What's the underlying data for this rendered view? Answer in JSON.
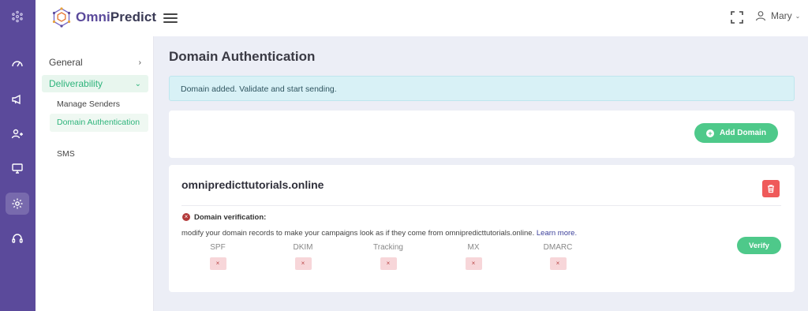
{
  "app": {
    "brand_part1": "Omni",
    "brand_part2": "Predict"
  },
  "rail": {
    "icons": [
      "network-icon",
      "speedometer-icon",
      "megaphone-icon",
      "users-icon",
      "monitor-icon",
      "gear-icon",
      "headset-icon"
    ],
    "active": "gear-icon"
  },
  "topbar": {
    "user_name": "Mary",
    "user_caret": "⌄"
  },
  "subnav": {
    "general_label": "General",
    "general_chevron": "›",
    "deliverability_label": "Deliverability",
    "deliverability_chevron": "⌄",
    "items": [
      {
        "label": "Manage Senders"
      },
      {
        "label": "Domain Authentication"
      },
      {
        "label": "SMS"
      }
    ]
  },
  "main": {
    "title": "Domain Authentication",
    "alert": "Domain added. Validate and start sending.",
    "add_domain_label": "Add Domain",
    "add_domain_icon": "+",
    "domain": {
      "name": "omnipredicttutorials.online",
      "verification_icon": "×",
      "verification_title": "Domain verification:",
      "verification_desc": "modify your domain records to make your campaigns look as if they come from omnipredicttutorials.online.",
      "learn_more": "Learn more.",
      "records": [
        {
          "label": "SPF",
          "status": "×"
        },
        {
          "label": "DKIM",
          "status": "×"
        },
        {
          "label": "Tracking",
          "status": "×"
        },
        {
          "label": "MX",
          "status": "×"
        },
        {
          "label": "DMARC",
          "status": "×"
        }
      ],
      "verify_label": "Verify"
    }
  },
  "colors": {
    "rail": "#5b4a9b",
    "accent_green": "#4ec98a",
    "danger": "#ef5a5a",
    "alert_bg": "#d8f1f6"
  }
}
